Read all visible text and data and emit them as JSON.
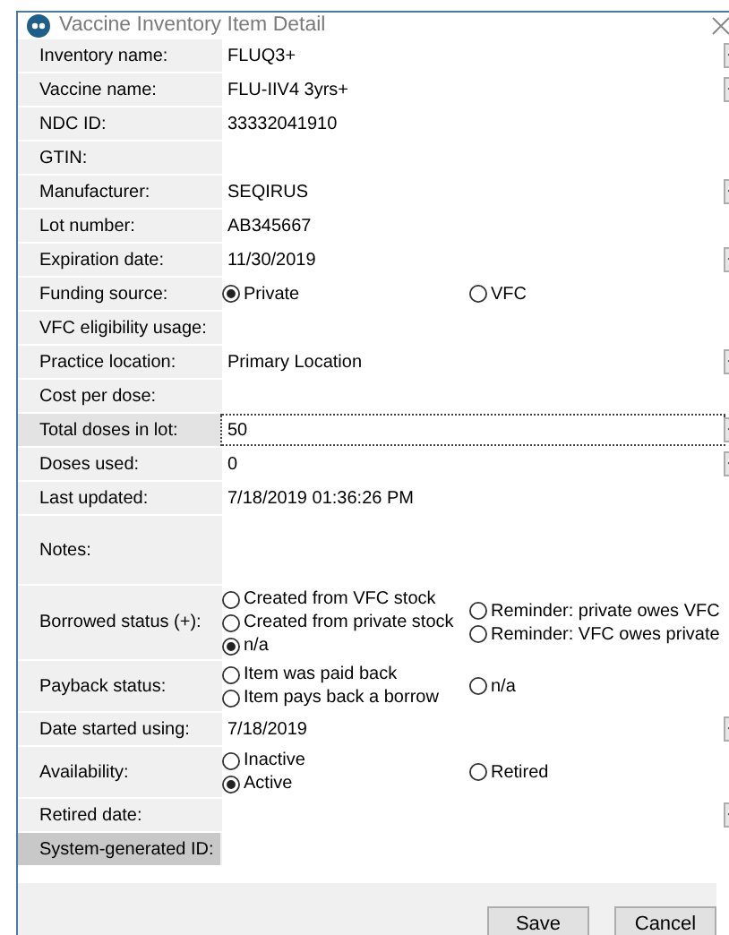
{
  "window": {
    "title": "Vaccine Inventory Item Detail"
  },
  "rows": [
    {
      "label": "Inventory name:",
      "kind": "dropdown",
      "value": "FLUQ3+",
      "focused": false
    },
    {
      "label": "Vaccine name:",
      "kind": "dropdown",
      "value": "FLU-IIV4 3yrs+",
      "focused": false
    },
    {
      "label": "NDC ID:",
      "kind": "text",
      "value": "33332041910",
      "focused": false
    },
    {
      "label": "GTIN:",
      "kind": "text",
      "focused": false
    },
    {
      "label": "Manufacturer:",
      "kind": "dropdown",
      "value": "SEQIRUS",
      "focused": false
    },
    {
      "label": "Lot number:",
      "kind": "text",
      "value": "AB345667",
      "focused": false
    },
    {
      "label": "Expiration date:",
      "kind": "dropdown",
      "value": "11/30/2019",
      "focused": false
    },
    {
      "label": "Funding source:",
      "kind": "radio",
      "columns": [
        [
          {
            "label": "Private",
            "selected": true
          }
        ],
        [
          {
            "label": "VFC",
            "selected": false
          }
        ]
      ],
      "focused": false
    },
    {
      "label": "VFC eligibility usage:",
      "kind": "text",
      "focused": false
    },
    {
      "label": "Practice location:",
      "kind": "dropdown",
      "value": "Primary Location",
      "focused": false
    },
    {
      "label": "Cost per dose:",
      "kind": "text",
      "focused": false
    },
    {
      "label": "Total doses in lot:",
      "kind": "dropdown",
      "value": "50",
      "focused": true
    },
    {
      "label": "Doses used:",
      "kind": "dropdown",
      "value": "0",
      "focused": false
    },
    {
      "label": "Last updated:",
      "kind": "text",
      "value": "7/18/2019 01:36:26 PM",
      "focused": false
    },
    {
      "label": "Notes:",
      "kind": "multiline",
      "focused": false
    },
    {
      "label": "Borrowed status (+):",
      "kind": "radio",
      "columns": [
        [
          {
            "label": "Created from VFC stock",
            "selected": false
          },
          {
            "label": "Created from private stock",
            "selected": false
          },
          {
            "label": "n/a",
            "selected": true
          }
        ],
        [
          {
            "label": "Reminder: private owes VFC",
            "selected": false
          },
          {
            "label": "Reminder: VFC owes private",
            "selected": false
          }
        ]
      ],
      "focused": false
    },
    {
      "label": "Payback status:",
      "kind": "radio",
      "columns": [
        [
          {
            "label": "Item was paid back",
            "selected": false
          },
          {
            "label": "Item pays back a borrow",
            "selected": false
          }
        ],
        [
          {
            "label": "n/a",
            "selected": false
          }
        ]
      ],
      "focused": false
    },
    {
      "label": "Date started using:",
      "kind": "dropdown",
      "value": "7/18/2019",
      "focused": false
    },
    {
      "label": "Availability:",
      "kind": "radio",
      "columns": [
        [
          {
            "label": "Inactive",
            "selected": false
          },
          {
            "label": "Active",
            "selected": true
          }
        ],
        [
          {
            "label": "Retired",
            "selected": false
          }
        ]
      ],
      "focused": false
    },
    {
      "label": "Retired date:",
      "kind": "dropdown",
      "focused": false
    },
    {
      "label": "System-generated ID:",
      "kind": "readonly",
      "focused": false
    }
  ],
  "buttons": [
    "Save",
    "Cancel"
  ]
}
